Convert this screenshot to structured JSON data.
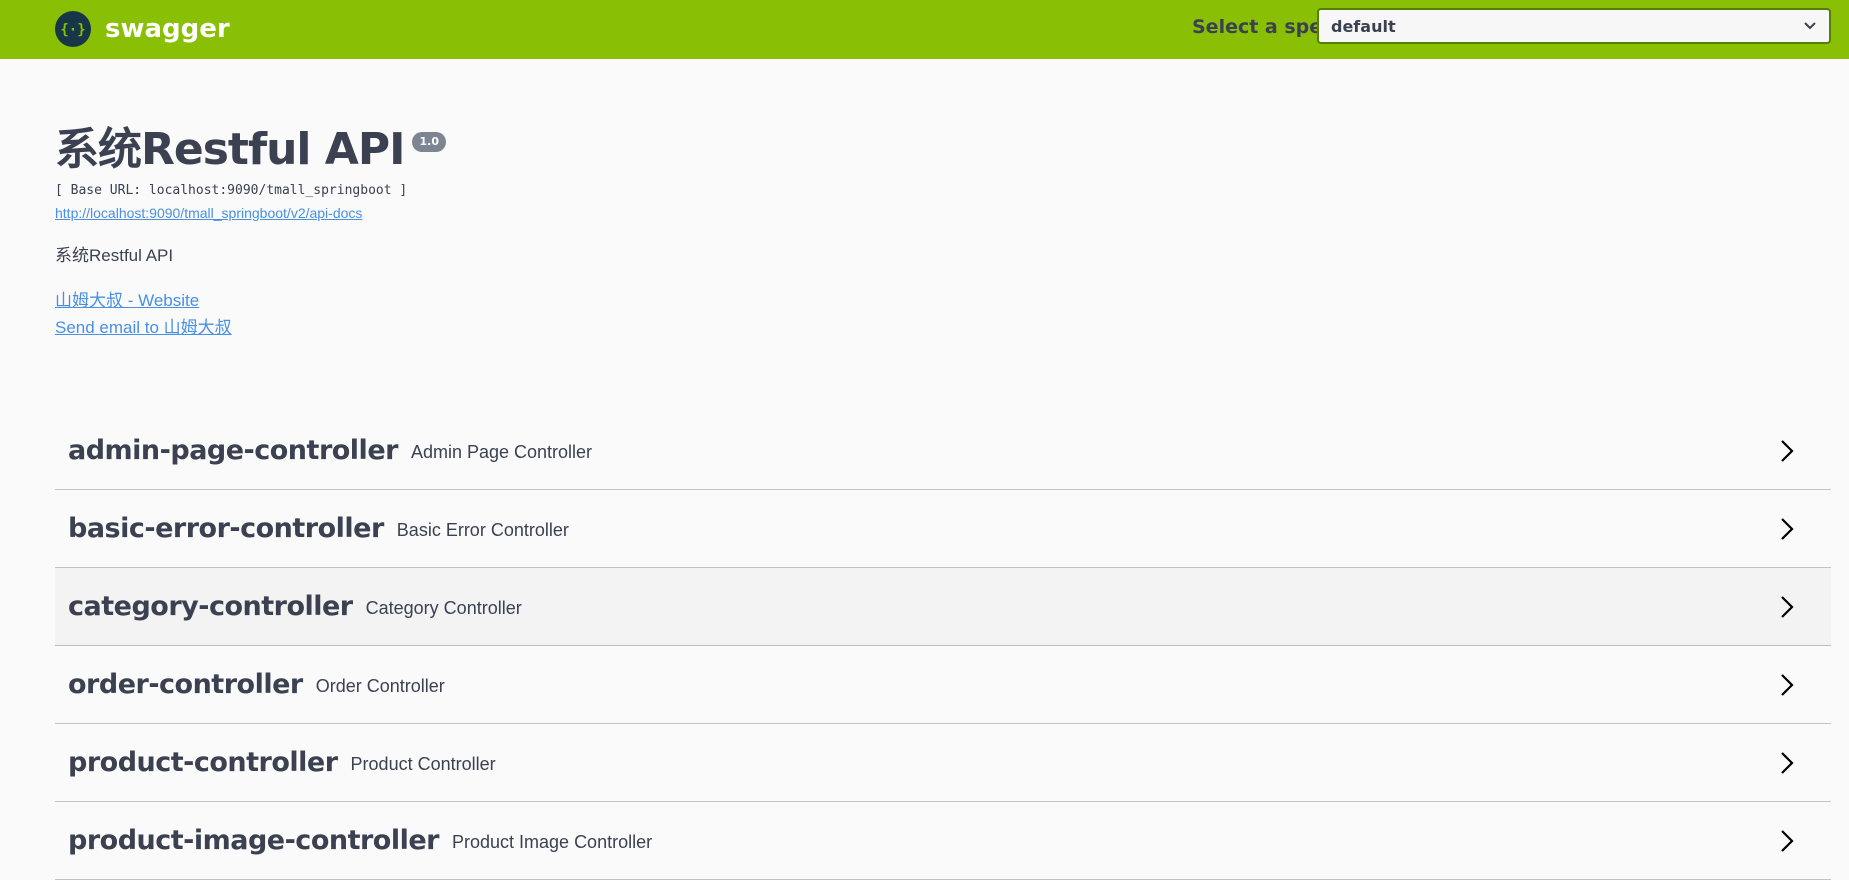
{
  "topbar": {
    "brand": "swagger",
    "spec_label": "Select a spec",
    "spec_value": "default",
    "accent_color": "#89bf04"
  },
  "info": {
    "title": "系统Restful API",
    "version": "1.0",
    "base_url": "[ Base URL: localhost:9090/tmall_springboot ]",
    "docs_url": "http://localhost:9090/tmall_springboot/v2/api-docs",
    "description": "系统Restful API",
    "website_link": "山姆大叔 - Website",
    "email_link": "Send email to 山姆大叔"
  },
  "tags": [
    {
      "name": "admin-page-controller",
      "desc": "Admin Page Controller"
    },
    {
      "name": "basic-error-controller",
      "desc": "Basic Error Controller"
    },
    {
      "name": "category-controller",
      "desc": "Category Controller"
    },
    {
      "name": "order-controller",
      "desc": "Order Controller"
    },
    {
      "name": "product-controller",
      "desc": "Product Controller"
    },
    {
      "name": "product-image-controller",
      "desc": "Product Image Controller"
    }
  ]
}
